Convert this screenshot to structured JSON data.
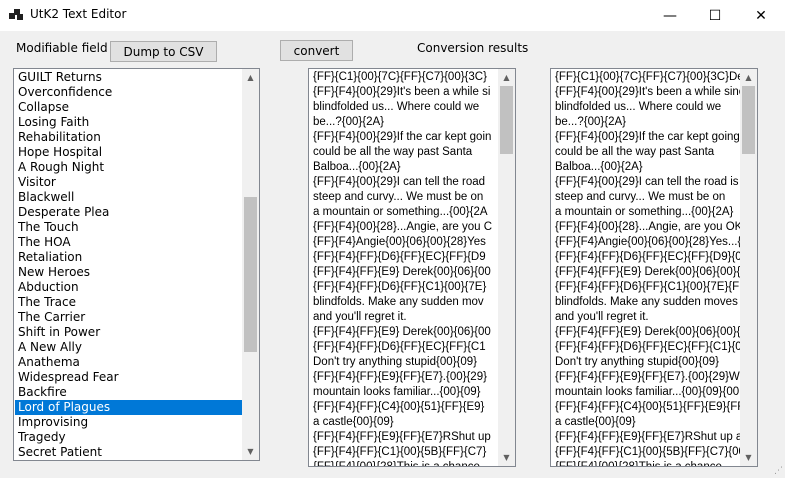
{
  "window": {
    "title": "UtK2 Text Editor",
    "minimize": "—",
    "maximize": "☐",
    "close": "✕"
  },
  "toolbar": {
    "modifiable_label": "Modifiable field",
    "dump_button": "Dump to CSV",
    "convert_button": "convert",
    "results_label": "Conversion results"
  },
  "list": {
    "selected_index": 22,
    "items": [
      "GUILT Returns",
      "Overconfidence",
      "Collapse",
      "Losing Faith",
      "Rehabilitation",
      "Hope Hospital",
      "A Rough Night",
      "Visitor",
      "Blackwell",
      "Desperate Plea",
      "The Touch",
      "The HOA",
      "Retaliation",
      "New Heroes",
      "Abduction",
      "The Trace",
      "The Carrier",
      "Shift in Power",
      "A New Ally",
      "Anathema",
      "Widespread Fear",
      "Backfire",
      "Lord of Plagues",
      "Improvising",
      "Tragedy",
      "Secret Patient"
    ]
  },
  "source_lines": [
    "{FF}{C1}{00}{7C}{FF}{C7}{00}{3C}",
    "{FF}{F4}{00}{29}It's been a while si",
    "blindfolded us... Where could we",
    "be...?{00}{2A}",
    "{FF}{F4}{00}{29}If the car kept goin",
    "could be all the way past Santa",
    "Balboa...{00}{2A}",
    "{FF}{F4}{00}{29}I can tell the road",
    "steep and curvy... We must be on",
    "a mountain or something...{00}{2A",
    "{FF}{F4}{00}{28}...Angie, are you C",
    "{FF}{F4}Angie{00}{06}{00}{28}Yes",
    "{FF}{F4}{FF}{D6}{FF}{EC}{FF}{D9",
    "{FF}{F4}{FF}{E9} Derek{00}{06}{00",
    "{FF}{F4}{FF}{D6}{FF}{C1}{00}{7E}",
    "blindfolds. Make any sudden mov",
    "and you'll regret it.",
    "{FF}{F4}{FF}{E9} Derek{00}{06}{00",
    "{FF}{F4}{FF}{D6}{FF}{EC}{FF}{C1",
    "Don't try anything stupid{00}{09}",
    "{FF}{F4}{FF}{E9}{FF}{E7}.{00}{29}",
    "mountain looks familiar...{00}{09}",
    "{FF}{F4}{FF}{C4}{00}{51}{FF}{E9}",
    "a castle{00}{09}",
    "{FF}{F4}{FF}{E9}{FF}{E7}RShut up",
    "{FF}{F4}{FF}{C1}{00}{5B}{FF}{C7}",
    "{FF}{F4}{00}{28}This is a chance"
  ],
  "result_lines": [
    "{FF}{C1}{00}{7C}{FF}{C7}{00}{3C}De",
    "{FF}{F4}{00}{29}It's been a while sinc",
    "blindfolded us... Where could we",
    "be...?{00}{2A}",
    "{FF}{F4}{00}{29}If the car kept going",
    "could be all the way past Santa",
    "Balboa...{00}{2A}",
    "{FF}{F4}{00}{29}I can tell the road is r",
    "steep and curvy... We must be on",
    "a mountain or something...{00}{2A}",
    "{FF}{F4}{00}{28}...Angie, are you OK?",
    "{FF}{F4}Angie{00}{06}{00}{28}Yes...{",
    "{FF}{F4}{FF}{D6}{FF}{EC}{FF}{D9}{0",
    "{FF}{F4}{FF}{E9} Derek{00}{06}{00}{",
    "{FF}{F4}{FF}{D6}{FF}{C1}{00}{7E}{FF",
    "blindfolds. Make any sudden moves",
    "and you'll regret it.",
    "{FF}{F4}{FF}{E9} Derek{00}{06}{00}{",
    "{FF}{F4}{FF}{D6}{FF}{EC}{FF}{C1}{0",
    "Don't try anything stupid{00}{09}",
    "{FF}{F4}{FF}{E9}{FF}{E7}.{00}{29}Wh",
    "mountain looks familiar...{00}{09}{00",
    "{FF}{F4}{FF}{C4}{00}{51}{FF}{E9}{FF",
    "a castle{00}{09}",
    "{FF}{F4}{FF}{E9}{FF}{E7}RShut up an",
    "{FF}{F4}{FF}{C1}{00}{5B}{FF}{C7}{00",
    "{FF}{F4}{00}{28}This is a chance"
  ],
  "scroll": {
    "list_fraction": 0.55,
    "source_fraction": 0.0,
    "result_fraction": 0.0
  },
  "colors": {
    "selection": "#0078d7",
    "window_bg": "#f0f0f0"
  }
}
